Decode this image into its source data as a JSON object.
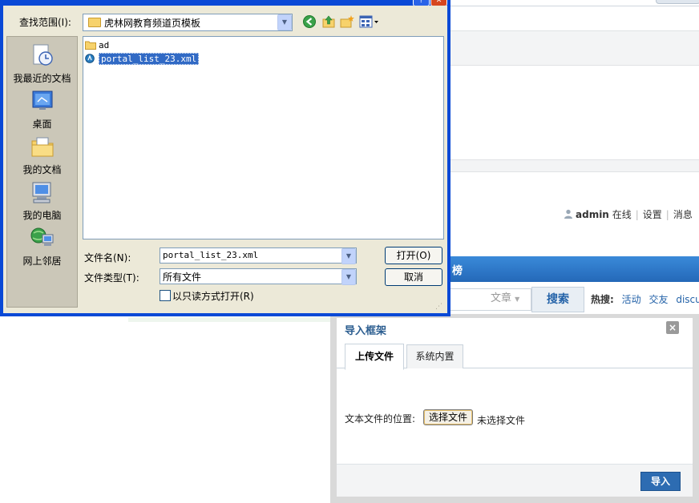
{
  "background": {
    "user_name": "admin",
    "user_status": "在线",
    "links": [
      "设置",
      "消息"
    ],
    "nav_item": "榜",
    "search_type": "文章",
    "search_button": "搜索",
    "hot_label": "热搜:",
    "hot_items": [
      "活动",
      "交友",
      "discuz"
    ]
  },
  "open_dialog": {
    "lookin_label": "查找范围(I):",
    "lookin_value": "虎林网教育频道页模板",
    "places": [
      {
        "label": "我最近的文档",
        "icon": "recent-documents-icon"
      },
      {
        "label": "桌面",
        "icon": "desktop-icon"
      },
      {
        "label": "我的文档",
        "icon": "my-documents-icon"
      },
      {
        "label": "我的电脑",
        "icon": "my-computer-icon"
      },
      {
        "label": "网上邻居",
        "icon": "network-places-icon"
      }
    ],
    "files": [
      {
        "name": "ad",
        "icon": "folder-icon",
        "selected": false
      },
      {
        "name": "portal_list_23.xml",
        "icon": "xml-file-icon",
        "selected": true
      }
    ],
    "filename_label": "文件名(N):",
    "filename_value": "portal_list_23.xml",
    "filetype_label": "文件类型(T):",
    "filetype_value": "所有文件",
    "open_button": "打开(O)",
    "cancel_button": "取消",
    "readonly_label": "以只读方式打开(R)"
  },
  "import_dialog": {
    "title": "导入框架",
    "close": "×",
    "tabs": [
      "上传文件",
      "系统内置"
    ],
    "file_label": "文本文件的位置:",
    "choose_button": "选择文件",
    "no_file": "未选择文件",
    "import_button": "导入"
  }
}
